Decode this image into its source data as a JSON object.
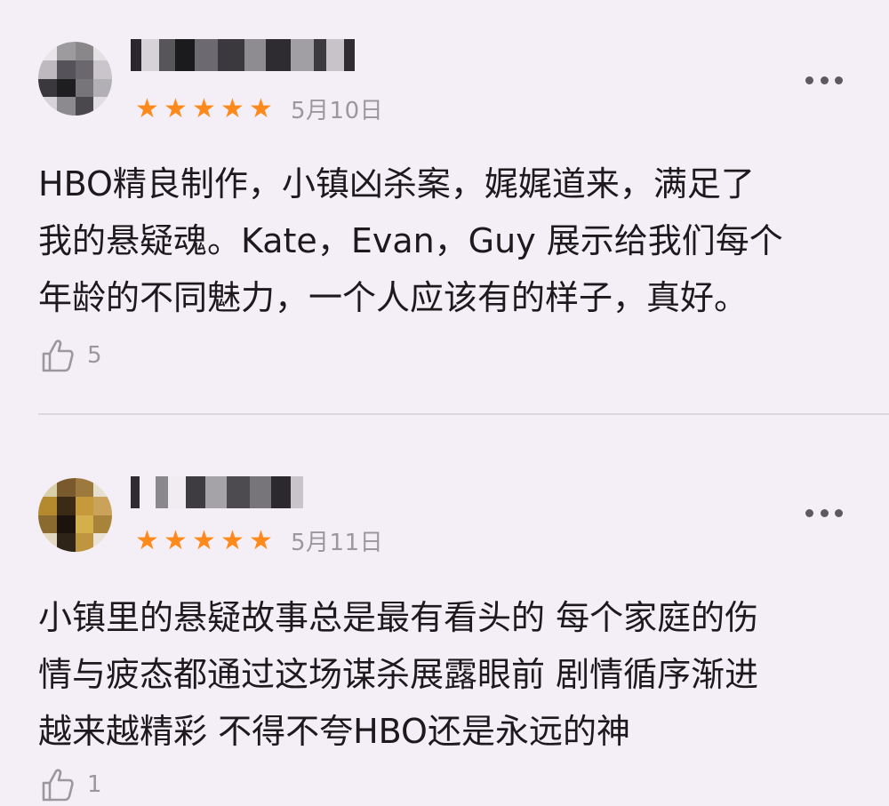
{
  "reviews": [
    {
      "rating": 5,
      "stars": "★★★★★",
      "date": "5月10日",
      "content": "HBO精良制作，小镇凶杀案，娓娓道来，满足了\n我的悬疑魂。Kate，Evan，Guy 展示给我们每个\n年龄的不同魅力，一个人应该有的样子，真好。",
      "likes": "5",
      "username_redacted": true,
      "avatar_redacted": true
    },
    {
      "rating": 5,
      "stars": "★★★★★",
      "date": "5月11日",
      "content": "小镇里的悬疑故事总是最有看头的 每个家庭的伤\n情与疲态都通过这场谋杀展露眼前 剧情循序渐进\n越来越精彩 不得不夸HBO还是永远的神",
      "likes": "1",
      "username_redacted": true,
      "avatar_redacted": true
    }
  ],
  "icons": {
    "star": "star-icon",
    "more": "more-icon",
    "like": "thumbs-up-icon"
  },
  "colors": {
    "background": "#f4eff6",
    "star": "#ff8a1c",
    "meta_text": "#9b989d",
    "body_text": "#1c1a1d",
    "divider": "#dcd6de"
  }
}
